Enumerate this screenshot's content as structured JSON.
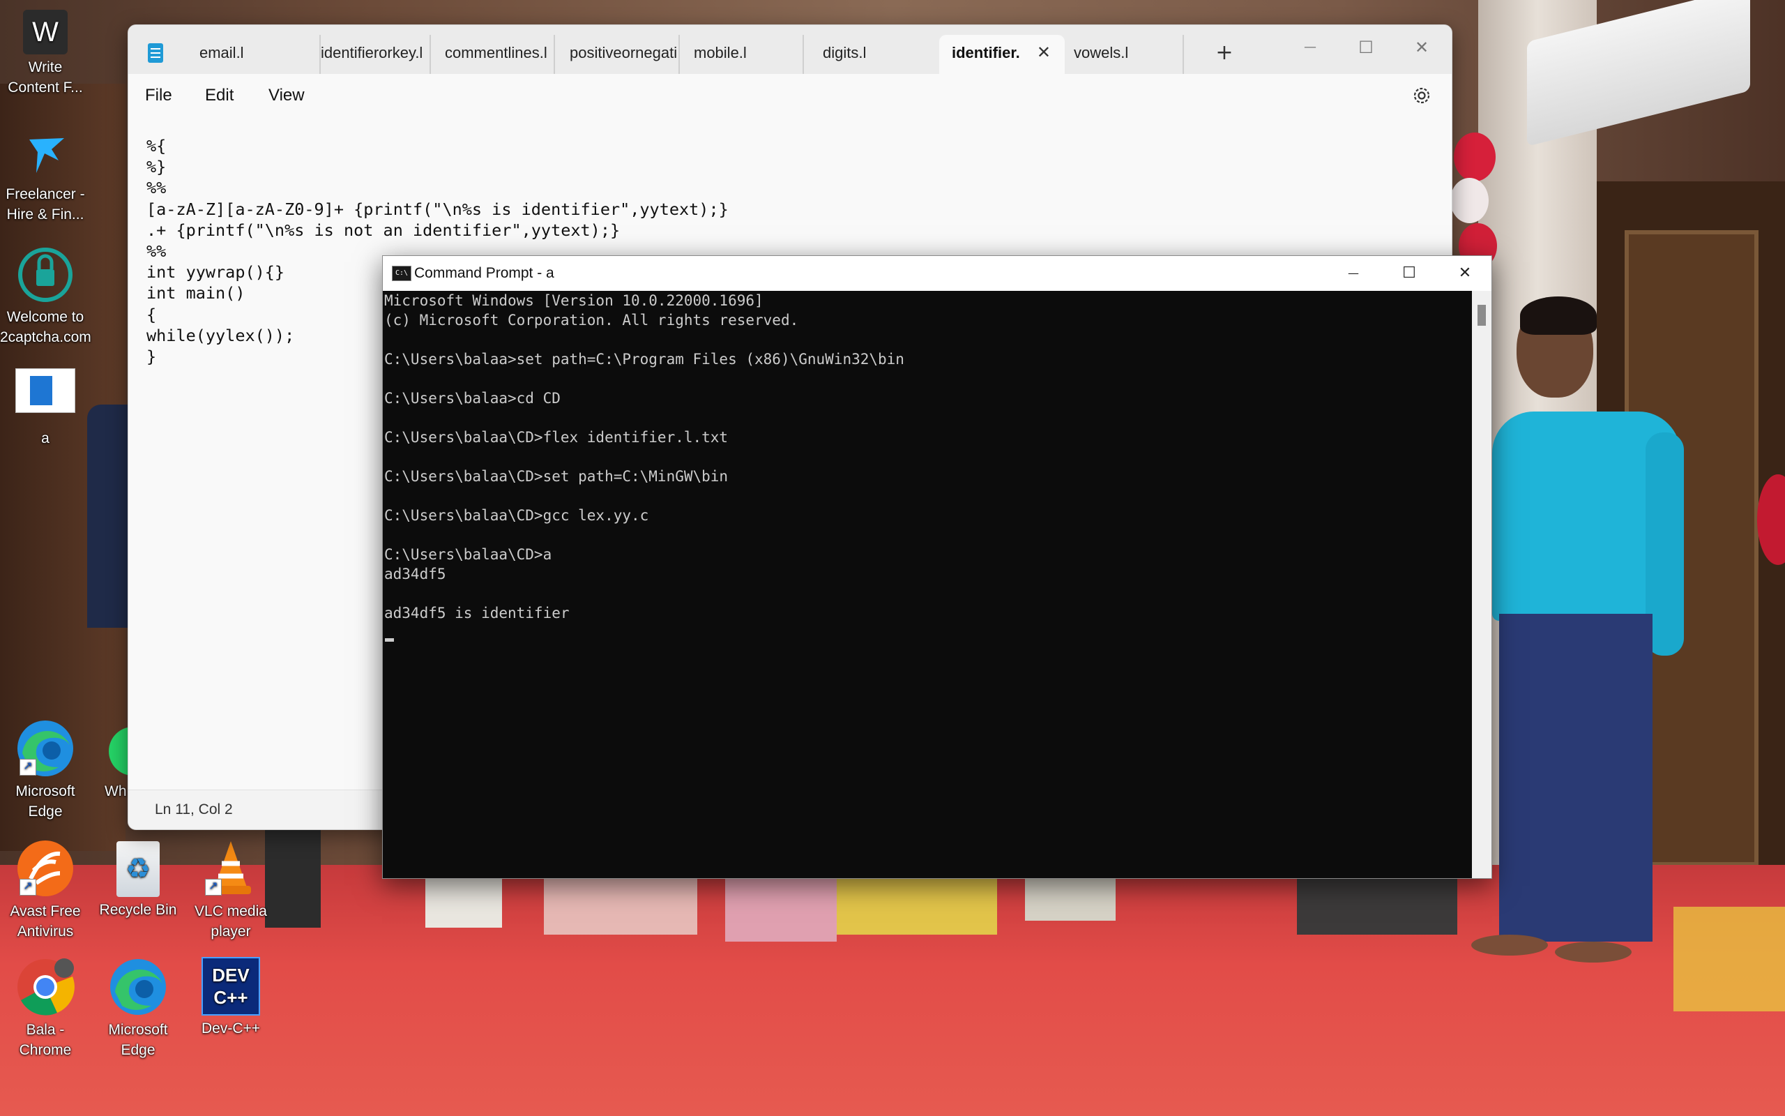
{
  "desktop_icons": [
    {
      "id": "write",
      "label": "Write\nContent F...",
      "glyph": "W"
    },
    {
      "id": "freelancer",
      "label": "Freelancer -\nHire & Fin...",
      "glyph": ""
    },
    {
      "id": "captcha",
      "label": "Welcome to\n2captcha.com",
      "glyph": ""
    },
    {
      "id": "a-file",
      "label": "a",
      "glyph": ""
    },
    {
      "id": "edge1",
      "label": "Microsoft\nEdge",
      "glyph": ""
    },
    {
      "id": "whatsapp",
      "label": "Wh",
      "glyph": ""
    },
    {
      "id": "avast",
      "label": "Avast Free\nAntivirus",
      "glyph": ""
    },
    {
      "id": "recycle",
      "label": "Recycle Bin",
      "glyph": "♻"
    },
    {
      "id": "vlc",
      "label": "VLC media\nplayer",
      "glyph": ""
    },
    {
      "id": "chrome",
      "label": "Bala -\nChrome",
      "glyph": ""
    },
    {
      "id": "edge2",
      "label": "Microsoft\nEdge",
      "glyph": ""
    },
    {
      "id": "devcpp",
      "label": "Dev-C++",
      "glyph": "DEV\nC++"
    }
  ],
  "notepad": {
    "tabs": [
      "email.l",
      "identifierorkey.l",
      "commentlines.l",
      "positiveornegati",
      "mobile.l",
      "digits.l",
      "identifier.",
      "vowels.l"
    ],
    "active_tab": "identifier.",
    "tab_close": "✕",
    "new_tab": "+",
    "menu": {
      "file": "File",
      "edit": "Edit",
      "view": "View"
    },
    "window_buttons": {
      "minimize": "—",
      "maximize": "☐",
      "close": "✕"
    },
    "content": "%{\n%}\n%%\n[a-zA-Z][a-zA-Z0-9]+ {printf(\"\\n%s is identifier\",yytext);}\n.+ {printf(\"\\n%s is not an identifier\",yytext);}\n%%\nint yywrap(){}\nint main()\n{\nwhile(yylex());\n}",
    "status": "Ln 11, Col 2"
  },
  "cmd": {
    "title": "Command Prompt - a",
    "icon": "C:\\",
    "window_buttons": {
      "minimize": "—",
      "maximize": "☐",
      "close": "✕"
    },
    "output": "Microsoft Windows [Version 10.0.22000.1696]\n(c) Microsoft Corporation. All rights reserved.\n\nC:\\Users\\balaa>set path=C:\\Program Files (x86)\\GnuWin32\\bin\n\nC:\\Users\\balaa>cd CD\n\nC:\\Users\\balaa\\CD>flex identifier.l.txt\n\nC:\\Users\\balaa\\CD>set path=C:\\MinGW\\bin\n\nC:\\Users\\balaa\\CD>gcc lex.yy.c\n\nC:\\Users\\balaa\\CD>a\nad34df5\n\nad34df5 is identifier"
  }
}
